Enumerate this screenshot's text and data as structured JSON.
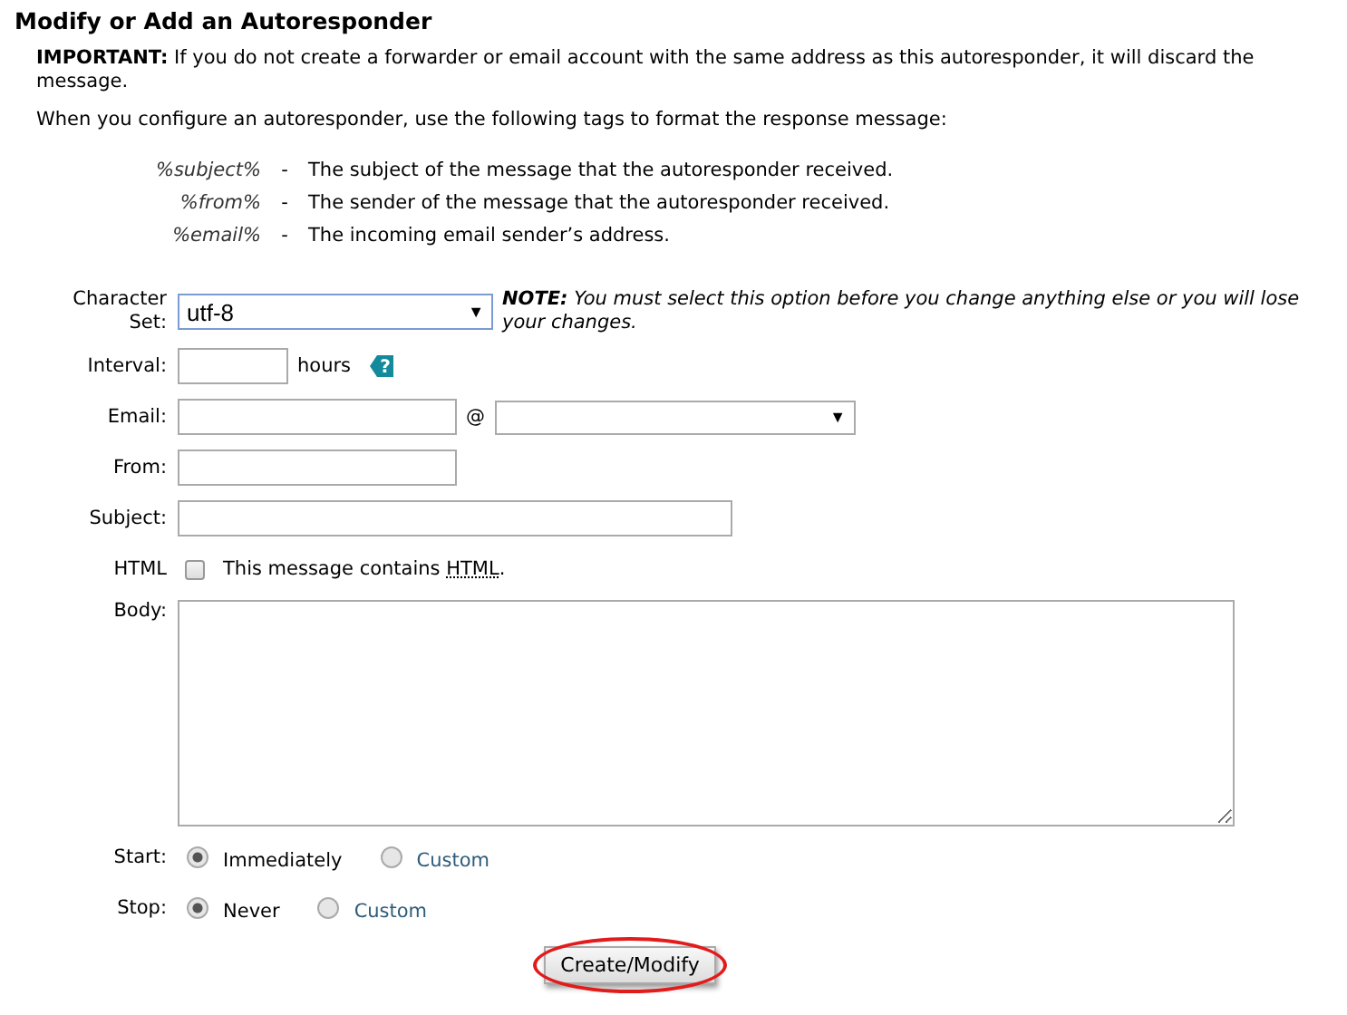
{
  "title": "Modify or Add an Autoresponder",
  "important": "**IMPORTANT:** If you do not create a forwarder or email account with the same address as this autoresponder, it will discard the message.",
  "intro": "When you configure an autoresponder, use the following tags to format the response message:",
  "tags": [
    {
      "tag": "%subject%",
      "dash": "-",
      "description": "The subject of the message that the autoresponder received."
    },
    {
      "tag": "%from%",
      "dash": "-",
      "description": "The sender of the message that the autoresponder received."
    },
    {
      "tag": "%email%",
      "dash": "-",
      "description": "The incoming email sender’s address."
    }
  ],
  "charset": {
    "label": "Character Set:",
    "value": "utf-8",
    "arrow": "▼",
    "note": "**NOTE:** You must select this option before you change anything else or you will lose your changes."
  },
  "interval": {
    "label": "Interval:",
    "unit": "hours",
    "help": "?"
  },
  "email": {
    "label": "Email:",
    "at": "@",
    "arrow": "▼"
  },
  "from": {
    "label": "From:"
  },
  "subject": {
    "label": "Subject:"
  },
  "html": {
    "label": "HTML",
    "checked": false,
    "text": "This message contains",
    "abbr": "HTML",
    "end": "."
  },
  "body": {
    "label": "Body:"
  },
  "start": {
    "label": "Start:",
    "options": [
      {
        "label": "Immediately",
        "selected": true
      },
      {
        "label": "Custom",
        "selected": false
      }
    ]
  },
  "stop": {
    "label": "Stop:",
    "options": [
      {
        "label": "Never",
        "selected": true
      },
      {
        "label": "Custom",
        "selected": false
      }
    ]
  },
  "submit": {
    "label": "Create/Modify",
    "highlighted": true
  }
}
